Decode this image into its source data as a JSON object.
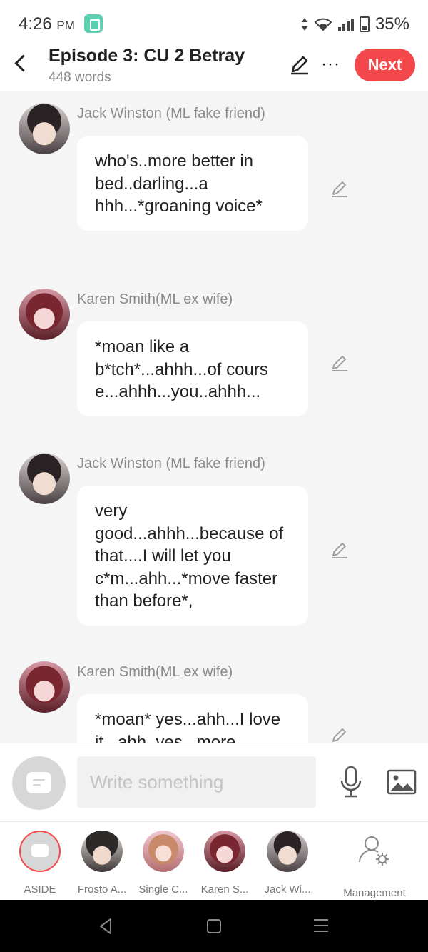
{
  "status_bar": {
    "time": "4:26",
    "ampm": "PM",
    "battery": "35%"
  },
  "header": {
    "title": "Episode 3: CU 2 Betray",
    "word_count": "448 words",
    "next_label": "Next",
    "more_label": "···"
  },
  "messages": [
    {
      "speaker": "Jack Winston (ML fake friend)",
      "avatar": "jack",
      "text": "who's..more better in bed..darling...a hhh...*groaning voice*"
    },
    {
      "speaker": "Karen Smith(ML ex wife)",
      "avatar": "karen",
      "text": "*moan like a b*tch*...ahhh...of cours e...ahhh...you..ahhh..."
    },
    {
      "speaker": "Jack Winston (ML fake friend)",
      "avatar": "jack",
      "text": "very good...ahhh...because of that....I will let you c*m...ahh...*move faster than before*,"
    },
    {
      "speaker": "Karen Smith(ML ex wife)",
      "avatar": "karen",
      "text": "*moan* yes...ahh...I love it...ahh..yes...more"
    }
  ],
  "input": {
    "placeholder": "Write something"
  },
  "tabs": [
    {
      "label": "ASIDE",
      "avatar": "aside"
    },
    {
      "label": "Frosto A...",
      "avatar": "frosto"
    },
    {
      "label": "Single C...",
      "avatar": "single"
    },
    {
      "label": "Karen S...",
      "avatar": "karen"
    },
    {
      "label": "Jack Wi...",
      "avatar": "jack"
    },
    {
      "label": "Management",
      "avatar": "management"
    }
  ],
  "colors": {
    "accent": "#f4474c",
    "background": "#f5f5f5",
    "bubble": "#ffffff",
    "muted_text": "#8a8a8a"
  }
}
